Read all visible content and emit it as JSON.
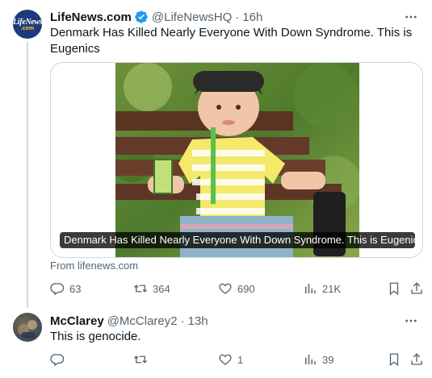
{
  "tweets": [
    {
      "author_name": "LifeNews.com",
      "handle": "@LifeNewsHQ",
      "separator": "·",
      "time": "16h",
      "avatar_text_top": "LifeNews",
      "avatar_text_bottom": ".com",
      "text": "Denmark Has Killed Nearly Everyone With Down Syndrome. This is Eugenics",
      "verified": true,
      "card": {
        "title": "Denmark Has Killed Nearly Everyone With Down Syndrome. This is Eugenics - L...",
        "source": "From lifenews.com"
      },
      "actions": {
        "replies": "63",
        "reposts": "364",
        "likes": "690",
        "views": "21K"
      }
    },
    {
      "author_name": "McClarey",
      "handle": "@McClarey2",
      "separator": "·",
      "time": "13h",
      "text": "This is genocide.",
      "actions": {
        "replies": "",
        "reposts": "",
        "likes": "1",
        "views": "39"
      }
    }
  ],
  "colors": {
    "text_primary": "#0f1419",
    "text_secondary": "#536471",
    "verified_blue": "#1d9bf0",
    "border": "#cfd9de"
  },
  "icons": [
    "more-icon",
    "verified-badge-icon",
    "reply-icon",
    "repost-icon",
    "like-icon",
    "views-icon",
    "bookmark-icon",
    "share-icon"
  ]
}
